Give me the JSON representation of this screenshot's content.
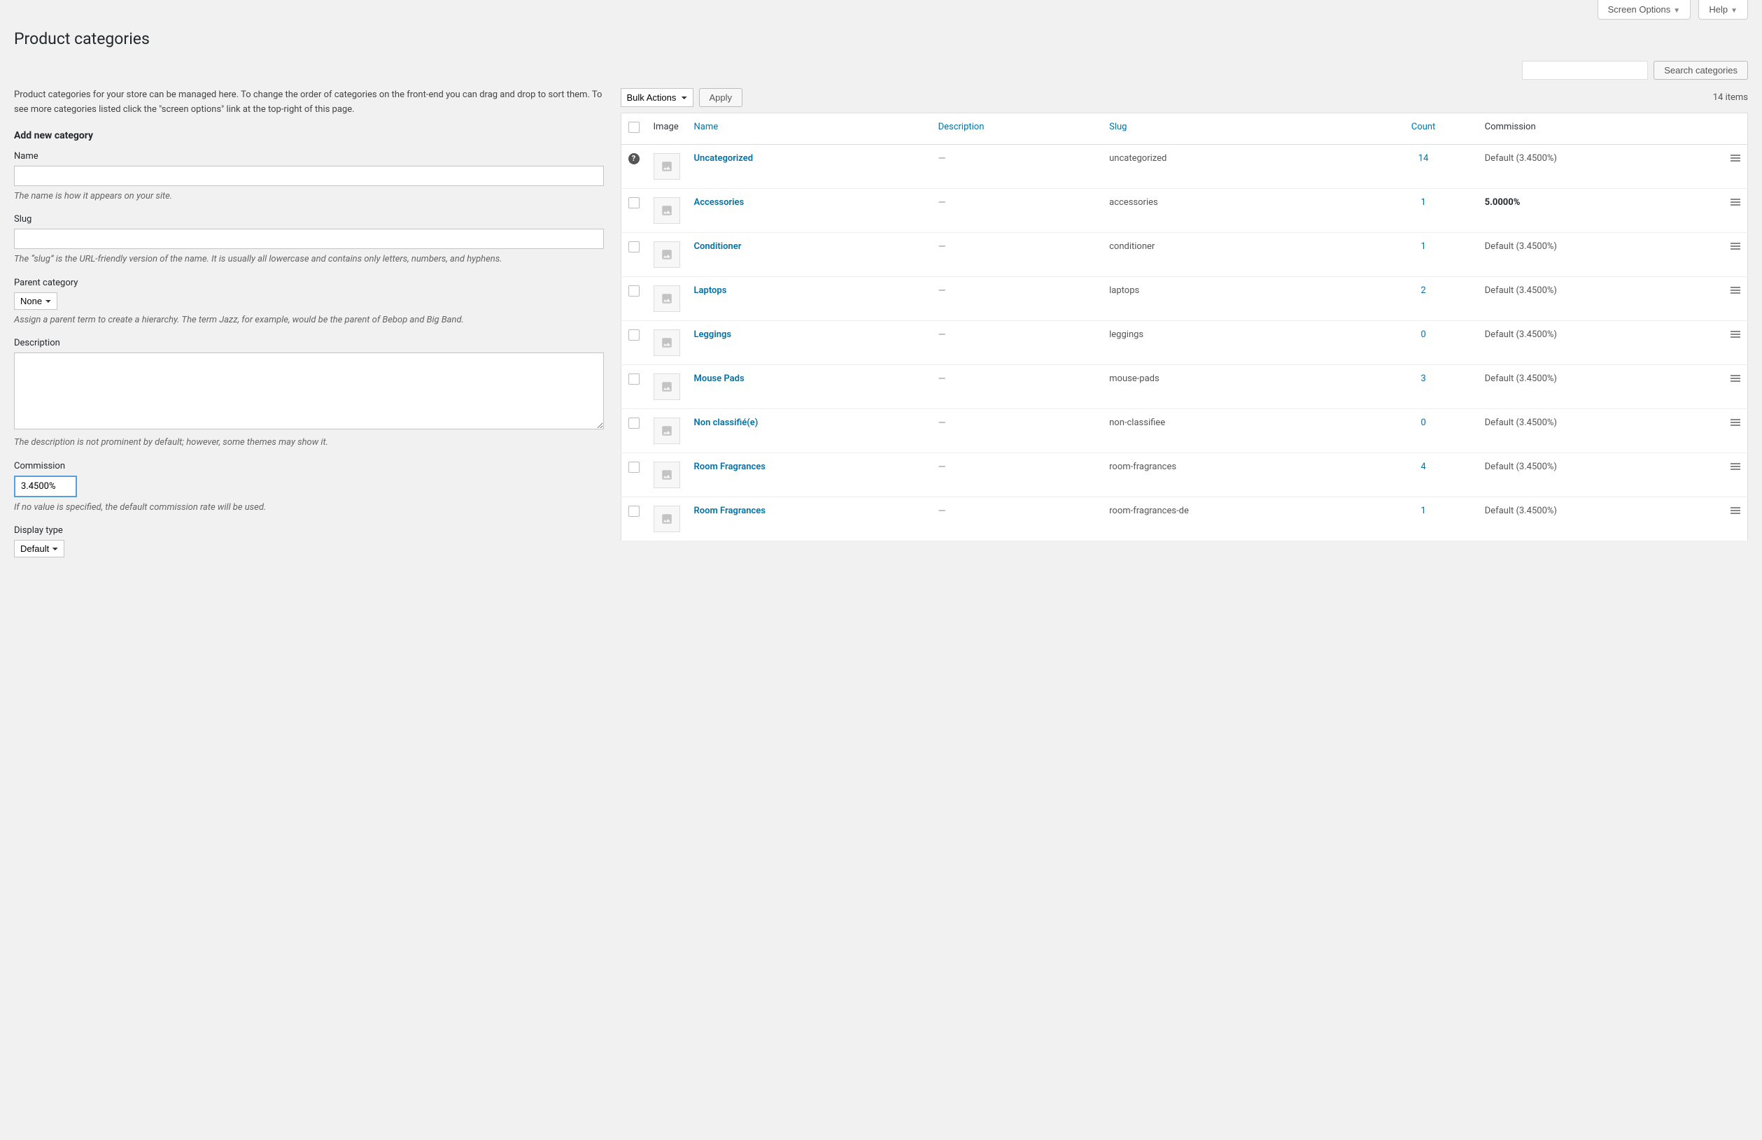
{
  "meta": {
    "screen_options": "Screen Options",
    "help": "Help"
  },
  "page_title": "Product categories",
  "search": {
    "button": "Search categories"
  },
  "intro": "Product categories for your store can be managed here. To change the order of categories on the front-end you can drag and drop to sort them. To see more categories listed click the \"screen options\" link at the top-right of this page.",
  "form": {
    "title": "Add new category",
    "name": {
      "label": "Name",
      "desc": "The name is how it appears on your site."
    },
    "slug": {
      "label": "Slug",
      "desc": "The “slug” is the URL-friendly version of the name. It is usually all lowercase and contains only letters, numbers, and hyphens."
    },
    "parent": {
      "label": "Parent category",
      "value": "None",
      "desc": "Assign a parent term to create a hierarchy. The term Jazz, for example, would be the parent of Bebop and Big Band."
    },
    "description": {
      "label": "Description",
      "desc": "The description is not prominent by default; however, some themes may show it."
    },
    "commission": {
      "label": "Commission",
      "value": "3.4500%",
      "desc": "If no value is specified, the default commission rate will be used."
    },
    "display_type": {
      "label": "Display type",
      "value": "Default"
    }
  },
  "tablenav": {
    "bulk_actions": "Bulk Actions",
    "apply": "Apply",
    "items_count": "14 items"
  },
  "columns": {
    "image": "Image",
    "name": "Name",
    "description": "Description",
    "slug": "Slug",
    "count": "Count",
    "commission": "Commission"
  },
  "rows": [
    {
      "name": "Uncategorized",
      "slug": "uncategorized",
      "count": "14",
      "commission": "Default (3.4500%)",
      "bold": false,
      "help": true
    },
    {
      "name": "Accessories",
      "slug": "accessories",
      "count": "1",
      "commission": "5.0000%",
      "bold": true,
      "help": false
    },
    {
      "name": "Conditioner",
      "slug": "conditioner",
      "count": "1",
      "commission": "Default (3.4500%)",
      "bold": false,
      "help": false
    },
    {
      "name": "Laptops",
      "slug": "laptops",
      "count": "2",
      "commission": "Default (3.4500%)",
      "bold": false,
      "help": false
    },
    {
      "name": "Leggings",
      "slug": "leggings",
      "count": "0",
      "commission": "Default (3.4500%)",
      "bold": false,
      "help": false
    },
    {
      "name": "Mouse Pads",
      "slug": "mouse-pads",
      "count": "3",
      "commission": "Default (3.4500%)",
      "bold": false,
      "help": false
    },
    {
      "name": "Non classifié(e)",
      "slug": "non-classifiee",
      "count": "0",
      "commission": "Default (3.4500%)",
      "bold": false,
      "help": false
    },
    {
      "name": "Room Fragrances",
      "slug": "room-fragrances",
      "count": "4",
      "commission": "Default (3.4500%)",
      "bold": false,
      "help": false
    },
    {
      "name": "Room Fragrances",
      "slug": "room-fragrances-de",
      "count": "1",
      "commission": "Default (3.4500%)",
      "bold": false,
      "help": false
    }
  ]
}
